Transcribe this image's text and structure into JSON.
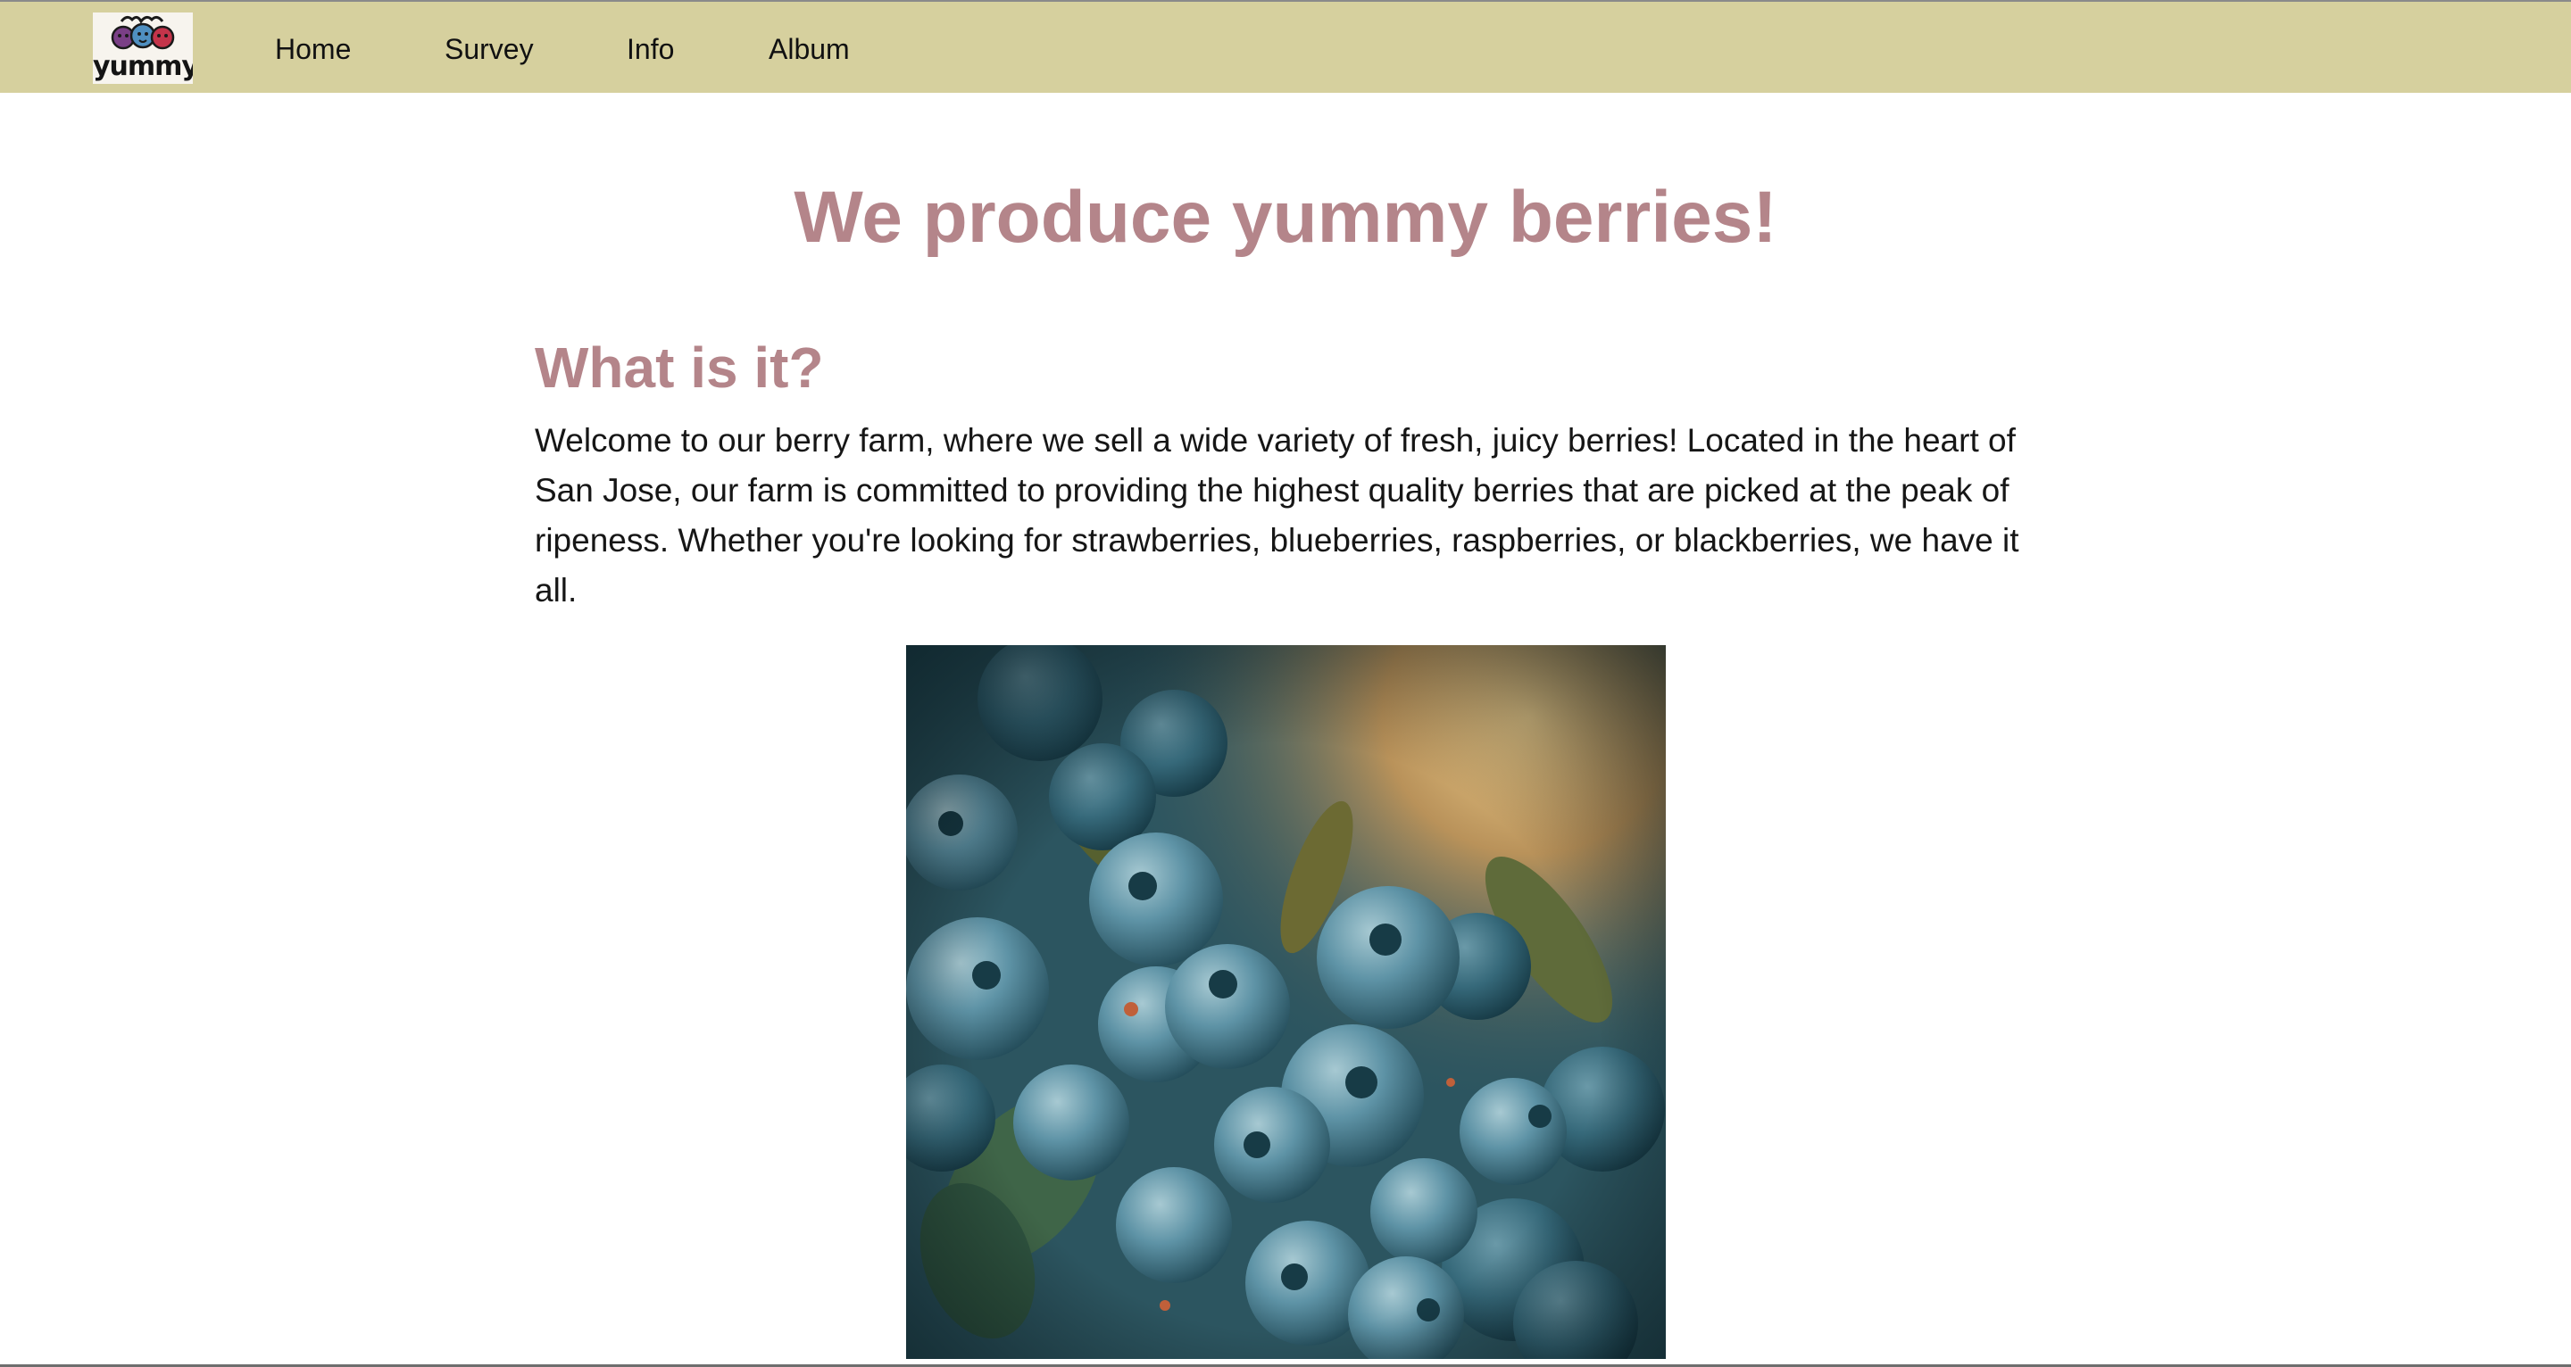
{
  "logo": {
    "text": "yummy",
    "berry_colors": [
      "#7a3f86",
      "#4f8fc0",
      "#c4344a"
    ]
  },
  "nav": {
    "items": [
      {
        "label": "Home"
      },
      {
        "label": "Survey"
      },
      {
        "label": "Info"
      },
      {
        "label": "Album"
      }
    ],
    "background": "#d6d09e"
  },
  "hero": {
    "title": "We produce yummy berries!"
  },
  "about": {
    "heading": "What is it?",
    "text": "Welcome to our berry farm, where we sell a wide variety of fresh, juicy berries! Located in the heart of San Jose, our farm is committed to providing the highest quality berries that are picked at the peak of ripeness. Whether you're looking for strawberries, blueberries, raspberries, or blackberries, we have it all."
  },
  "colors": {
    "heading": "#b4858a",
    "body_text": "#161616",
    "berry": "#4f8fa3"
  }
}
